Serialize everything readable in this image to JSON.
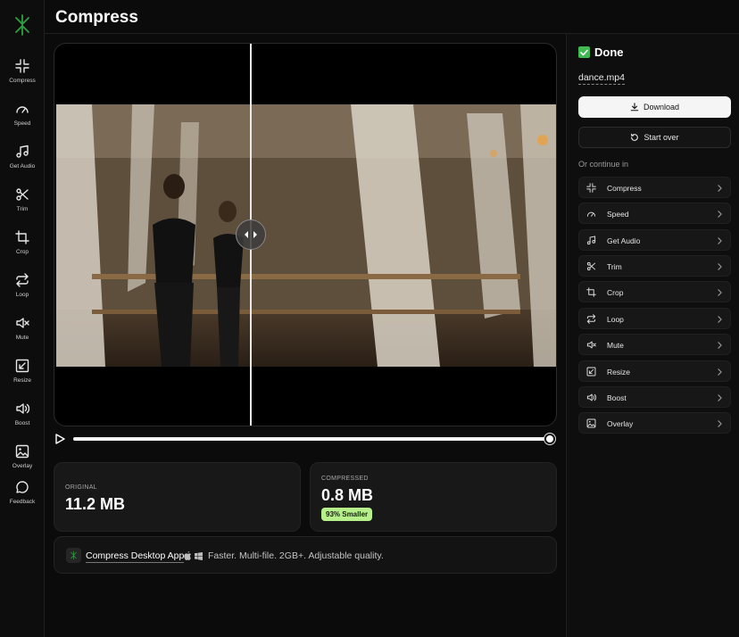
{
  "app": {
    "title": "Compress",
    "accent": "#2ea043"
  },
  "sidebar": {
    "items": [
      {
        "label": "Compress",
        "icon": "compress-icon"
      },
      {
        "label": "Speed",
        "icon": "speed-icon"
      },
      {
        "label": "Get Audio",
        "icon": "music-icon"
      },
      {
        "label": "Trim",
        "icon": "scissors-icon"
      },
      {
        "label": "Crop",
        "icon": "crop-icon"
      },
      {
        "label": "Loop",
        "icon": "loop-icon"
      },
      {
        "label": "Mute",
        "icon": "mute-icon"
      },
      {
        "label": "Resize",
        "icon": "resize-icon"
      },
      {
        "label": "Boost",
        "icon": "boost-icon"
      },
      {
        "label": "Overlay",
        "icon": "image-icon"
      },
      {
        "label": "Feedback",
        "icon": "chat-icon"
      }
    ]
  },
  "player": {
    "comparison_split": 0.39,
    "progress": 1.0
  },
  "stats": {
    "original_label": "ORIGINAL",
    "original_value": "11.2 MB",
    "compressed_label": "COMPRESSED",
    "compressed_value": "0.8 MB",
    "reduction_badge": "93% Smaller",
    "badge_color": "#b7f08a"
  },
  "promo": {
    "app_name": "Compress Desktop App",
    "description": "Faster. Multi-file. 2GB+. Adjustable quality."
  },
  "panel": {
    "status": "Done",
    "filename": "dance.mp4",
    "download_label": "Download",
    "start_over_label": "Start over",
    "continue_label": "Or continue in",
    "tools": [
      {
        "label": "Compress",
        "icon": "compress-icon"
      },
      {
        "label": "Speed",
        "icon": "speed-icon"
      },
      {
        "label": "Get Audio",
        "icon": "music-icon"
      },
      {
        "label": "Trim",
        "icon": "scissors-icon"
      },
      {
        "label": "Crop",
        "icon": "crop-icon"
      },
      {
        "label": "Loop",
        "icon": "loop-icon"
      },
      {
        "label": "Mute",
        "icon": "mute-icon"
      },
      {
        "label": "Resize",
        "icon": "resize-icon"
      },
      {
        "label": "Boost",
        "icon": "boost-icon"
      },
      {
        "label": "Overlay",
        "icon": "image-icon"
      }
    ]
  }
}
